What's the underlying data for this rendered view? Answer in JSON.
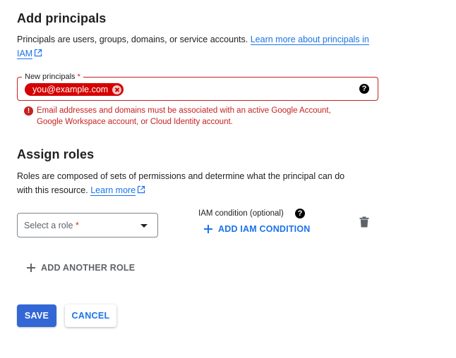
{
  "add_principals": {
    "title": "Add principals",
    "description": "Principals are users, groups, domains, or service accounts.",
    "learn_more_link": "Learn more about principals in IAM",
    "field": {
      "label": "New principals",
      "required_marker": "*",
      "chips": [
        {
          "value": "you@example.com",
          "status": "error"
        }
      ]
    },
    "error": {
      "line1": "Email addresses and domains must be associated with an active Google Account,",
      "line2": "Google Workspace account, or Cloud Identity account."
    }
  },
  "assign_roles": {
    "title": "Assign roles",
    "description_line1": "Roles are composed of sets of permissions and determine what the principal can do",
    "description_line2": "with this resource.",
    "learn_more_link": "Learn more",
    "role_select": {
      "placeholder": "Select a role",
      "required_marker": "*"
    },
    "iam_condition": {
      "label": "IAM condition (optional)",
      "add_label": "ADD IAM CONDITION"
    },
    "add_another_role_label": "ADD ANOTHER ROLE"
  },
  "actions": {
    "save_label": "SAVE",
    "cancel_label": "CANCEL"
  },
  "colors": {
    "accent": "#1a73e8",
    "primary_button": "#3367d6",
    "error": "#c5221f",
    "chip_error": "#d50000"
  }
}
